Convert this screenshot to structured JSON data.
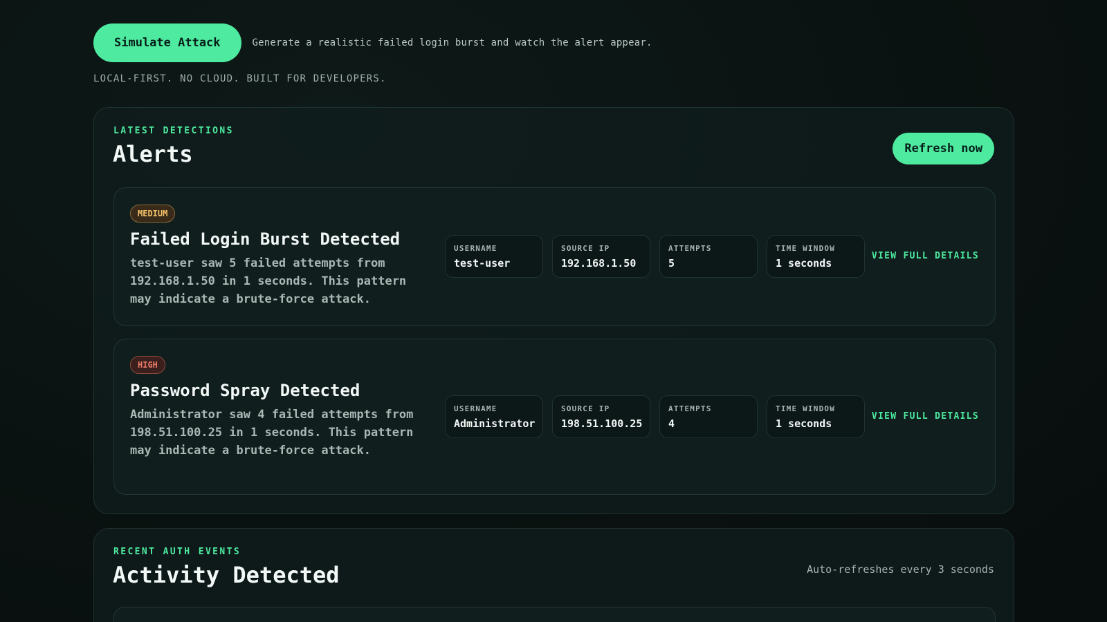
{
  "toolbar": {
    "simulate_label": "Simulate Attack",
    "simulate_desc": "Generate a realistic failed login burst and watch the alert appear.",
    "tagline": "LOCAL-FIRST. NO CLOUD. BUILT FOR DEVELOPERS."
  },
  "alerts_panel": {
    "eyebrow": "LATEST DETECTIONS",
    "title": "Alerts",
    "refresh_label": "Refresh now",
    "items": [
      {
        "severity": "MEDIUM",
        "title": "Failed Login Burst Detected",
        "description": "test-user saw 5 failed attempts from 192.168.1.50 in 1 seconds. This pattern may indicate a brute-force attack.",
        "stats": [
          {
            "label": "USERNAME",
            "value": "test-user"
          },
          {
            "label": "SOURCE IP",
            "value": "192.168.1.50"
          },
          {
            "label": "ATTEMPTS",
            "value": "5"
          },
          {
            "label": "TIME WINDOW",
            "value": "1 seconds"
          }
        ],
        "link_label": "VIEW FULL DETAILS"
      },
      {
        "severity": "HIGH",
        "title": "Password Spray Detected",
        "description": "Administrator saw 4 failed attempts from 198.51.100.25 in 1 seconds. This pattern may indicate a brute-force attack.",
        "stats": [
          {
            "label": "USERNAME",
            "value": "Administrator"
          },
          {
            "label": "SOURCE IP",
            "value": "198.51.100.25"
          },
          {
            "label": "ATTEMPTS",
            "value": "4"
          },
          {
            "label": "TIME WINDOW",
            "value": "1 seconds"
          }
        ],
        "link_label": "VIEW FULL DETAILS"
      }
    ]
  },
  "activity_panel": {
    "eyebrow": "RECENT AUTH EVENTS",
    "title": "Activity Detected",
    "auto_refresh": "Auto-refreshes every 3 seconds"
  },
  "colors": {
    "accent": "#4eeaa0",
    "medium": "#f5c46a",
    "high": "#e97a68",
    "background": "#0a1211"
  }
}
